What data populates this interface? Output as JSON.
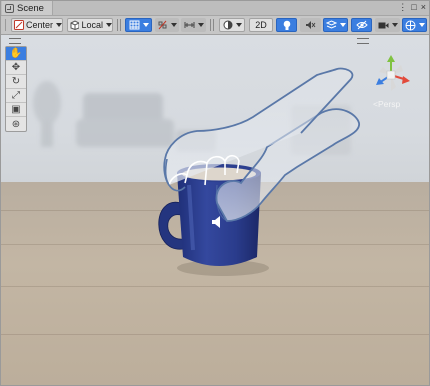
{
  "window": {
    "tab_title": "Scene",
    "buttons": [
      "⋮",
      "□",
      "×"
    ]
  },
  "toolbar": {
    "pivot_label": "Center",
    "space_label": "Local",
    "mode_2d_label": "2D"
  },
  "tools": [
    {
      "name": "hand-tool",
      "glyph": "✋",
      "active": true
    },
    {
      "name": "move-tool",
      "glyph": "✥",
      "active": false
    },
    {
      "name": "rotate-tool",
      "glyph": "↻",
      "active": false
    },
    {
      "name": "scale-tool",
      "glyph": "⤢",
      "active": false
    },
    {
      "name": "rect-tool",
      "glyph": "▣",
      "active": false
    },
    {
      "name": "transform-tool",
      "glyph": "⊛",
      "active": false
    }
  ],
  "orientation_gizmo": {
    "projection_label": "Persp",
    "axis_colors": {
      "x": "#e24a3b",
      "y": "#7fc241",
      "z": "#3b7ee0"
    }
  },
  "colors": {
    "selected": "#3b7ee0",
    "hand_outline": "#5a78a8",
    "mug": "#2c3f8f"
  }
}
